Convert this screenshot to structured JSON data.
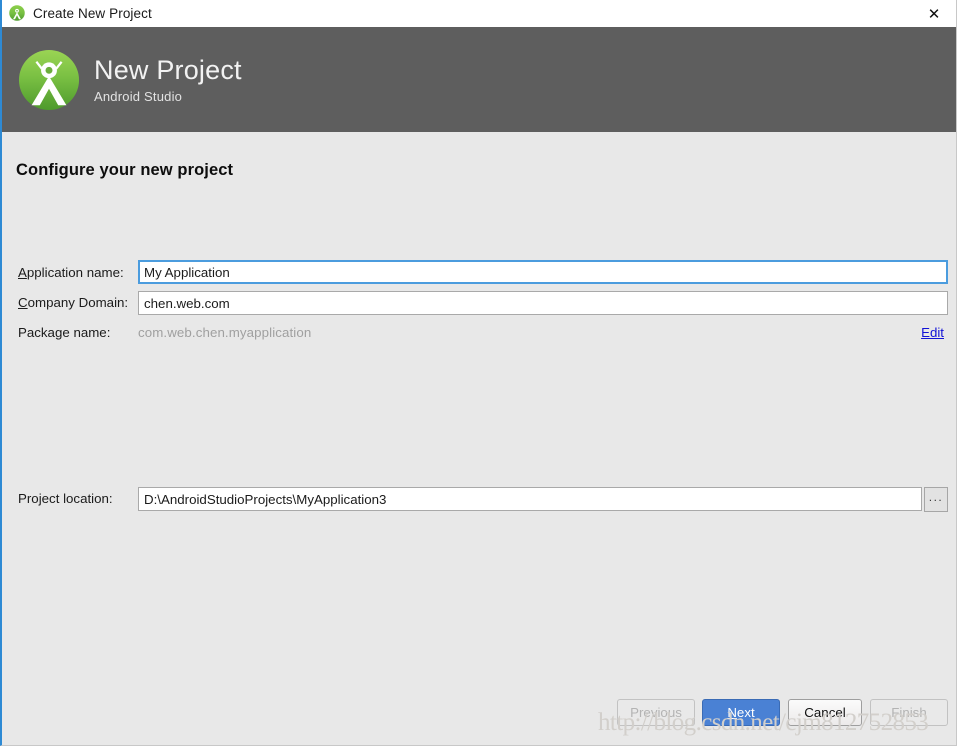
{
  "titlebar": {
    "title": "Create New Project",
    "icon": "android-studio-icon",
    "close_label": "✕"
  },
  "banner": {
    "title": "New Project",
    "subtitle": "Android Studio",
    "logo": "android-studio-logo"
  },
  "main": {
    "heading": "Configure your new project",
    "fields": {
      "application_name": {
        "label_prefix": "",
        "label_mnemonic": "A",
        "label_suffix": "pplication name:",
        "value": "My Application",
        "placeholder": "Application name"
      },
      "company_domain": {
        "label_prefix": "",
        "label_mnemonic": "C",
        "label_suffix": "ompany Domain:",
        "value": "chen.web.com",
        "placeholder": "Company domain"
      },
      "package_name": {
        "label": "Package name:",
        "value": "com.web.chen.myapplication",
        "edit_label": "Edit"
      },
      "project_location": {
        "label": "Project location:",
        "value": "D:\\AndroidStudioProjects\\MyApplication3",
        "placeholder": "Project location",
        "browse_label": "..."
      }
    }
  },
  "footer": {
    "previous_label": "Previous",
    "next_label_mnemonic": "N",
    "next_label_rest": "ext",
    "cancel_label": "Cancel",
    "finish_label": "Finish"
  },
  "watermark": {
    "text": "http://blog.csdn.net/cjm812752853"
  },
  "colors": {
    "banner_bg": "#5e5e5e",
    "body_bg": "#e8e8e8",
    "accent_blue": "#4a81d4",
    "focus_blue": "#4b9cde",
    "link_blue": "#1212d6",
    "window_border": "#2e8ad4",
    "disabled_text": "#b3b3b3",
    "package_value": "#a0a0a0"
  }
}
